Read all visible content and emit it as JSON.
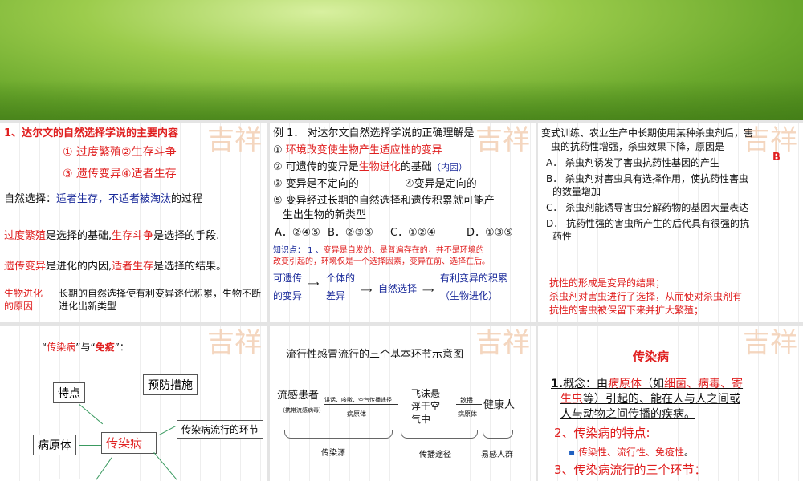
{
  "s1": {
    "title": "1、达尔文的自然选择学说的主要内容",
    "l1a": "① 过度繁殖",
    "l1b": "②生存斗争",
    "l2a": "③ 遗传变异",
    "l2b": "④适者生存",
    "ns_label": "自然选择：",
    "ns_blue": "适者生存，不适者被淘汰",
    "ns_end": "的过程",
    "f1": "过度繁殖",
    "t1": "是选择的基础,",
    "f2": "生存斗争",
    "t2": "是选择的手段.",
    "f3": "遗传变异",
    "t3": "是进化的内因,",
    "f4": "适者生存",
    "t4": "是选择的结果。",
    "cause_label": "生物进化的原因",
    "cause": "长期的自然选择使有利变异逐代积累，生物不断进化出新类型"
  },
  "s2": {
    "q": "例 1． 对达尔文自然选择学说的正确理解是",
    "o1n": "①",
    "o1": "环境改变使生物产生适应性的变异",
    "o2a": "②  可遗传的变异是",
    "o2r": "生物进化",
    "o2b": "的基础",
    "o2n": "（内因）",
    "o3": "③  变异是不定向的",
    "o4": "④变异是定向的",
    "o5a": "⑤ 变异经过长期的自然选择和遗传积累就可能产",
    "o5b": "生出生物的新类型",
    "ans": [
      "A．②④⑤",
      "B．②③⑤",
      "C．①②④",
      "D．①③⑤"
    ],
    "kp_label": "知识点： 1 、",
    "kp1": "变异是自发的、是普遍存在的，并不是环境的",
    "kp2": "改变引起的，环境仅是一个选择因素，变异在前、选择在后。",
    "flow": [
      "可遗传的变异",
      "个体的差异",
      "自然选择",
      "有利变异的积累（生物进化）"
    ]
  },
  "s3": {
    "q1": "变式训练、农业生产中长期使用某种杀虫剂后，害",
    "q2": "虫的抗药性增强，杀虫效果下降，原因是",
    "ans": "B",
    "a": "A． 杀虫剂诱发了害虫抗药性基因的产生",
    "b1": "B． 杀虫剂对害虫具有选择作用，使抗药性害虫",
    "b2": "的数量增加",
    "c": "C． 杀虫剂能诱导害虫分解药物的基因大量表达",
    "d1": "D． 抗药性强的害虫所产生的后代具有很强的抗",
    "d2": "药性",
    "e1": "抗性的形成是变异的结果；",
    "e2": "杀虫剂对害虫进行了选择，从而使对杀虫剂有",
    "e3": "抗性的害虫被保留下来并扩大繁殖；"
  },
  "s4": {
    "title_q1": "“",
    "title_r1": "传染病",
    "title_m": "”与“",
    "title_r2": "免疫",
    "title_q2": "”：",
    "boxes": {
      "features": "特点",
      "prevention": "预防措施",
      "center": "传染病",
      "pathogen": "病原体",
      "links": "传染病流行的环节"
    }
  },
  "s5": {
    "title": "流行性感冒流行的三个基本环节示意图",
    "patient": "流感患者",
    "carrier": "（携带流感病毒）",
    "route": "讲话、咳嗽、空气传播途径",
    "pathogen1": "病原体",
    "droplet": "飞沫悬浮于空气中",
    "spread": "散播",
    "pathogen2": "病原体",
    "healthy": "健康人",
    "g1": "传染源",
    "g2": "传播途径",
    "g3": "易感人群"
  },
  "s6": {
    "title": "传染病",
    "c_num": "1.",
    "c1": "概念：由",
    "c1r": "病原体",
    "c1b": "（如",
    "c1r2": "细菌、病毒、寄",
    "c2r": "生虫",
    "c2": "等）引起的、能在人与人之间或",
    "c3": "人与动物之间传播的疾病。",
    "h2": "2、传染病的特点:",
    "bullet": "传染性、流行性、免疫性",
    "bullet_end": "。",
    "h3": "3、传染病流行的三个环节："
  },
  "seal": "吉祥"
}
